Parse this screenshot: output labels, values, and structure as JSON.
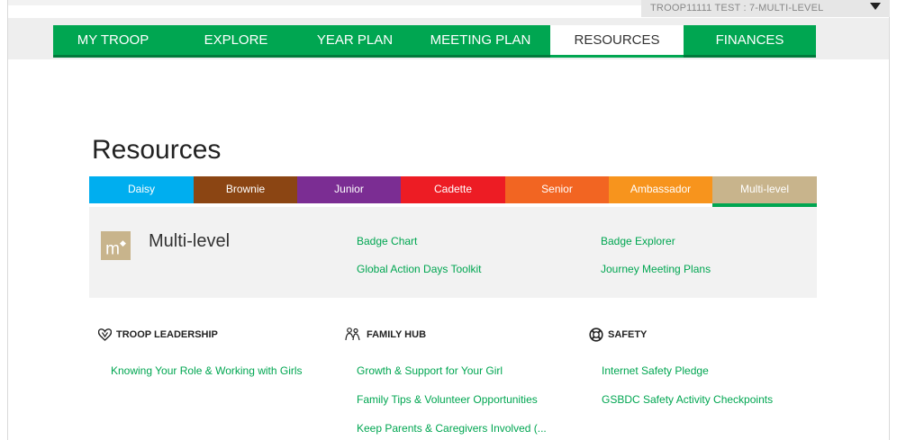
{
  "troop_selector": {
    "label": "TROOP11111 TEST : 7-MULTI-LEVEL"
  },
  "nav": {
    "items": [
      {
        "label": "MY TROOP"
      },
      {
        "label": "EXPLORE"
      },
      {
        "label": "YEAR PLAN"
      },
      {
        "label": "MEETING PLAN"
      },
      {
        "label": "RESOURCES"
      },
      {
        "label": "FINANCES"
      }
    ],
    "active": "RESOURCES"
  },
  "page_title": "Resources",
  "levels": [
    {
      "label": "Daisy",
      "color": "#00aeef"
    },
    {
      "label": "Brownie",
      "color": "#8b4513"
    },
    {
      "label": "Junior",
      "color": "#7b2d93"
    },
    {
      "label": "Cadette",
      "color": "#ed1c24"
    },
    {
      "label": "Senior",
      "color": "#f26522"
    },
    {
      "label": "Ambassador",
      "color": "#f7941d"
    },
    {
      "label": "Multi-level",
      "color": "#c8b48c"
    }
  ],
  "selected_level": {
    "badge": "m",
    "name": "Multi-level",
    "links": [
      "Badge Chart",
      "Global Action Days Toolkit",
      "Badge Explorer",
      "Journey Meeting Plans"
    ]
  },
  "sections": [
    {
      "title": "TROOP LEADERSHIP",
      "icon": "heart-hands-icon",
      "links": [
        "Knowing Your Role & Working with Girls"
      ]
    },
    {
      "title": "FAMILY HUB",
      "icon": "family-icon",
      "links": [
        "Growth & Support for Your Girl",
        "Family Tips & Volunteer Opportunities",
        "Keep Parents & Caregivers Involved (..."
      ]
    },
    {
      "title": "SAFETY",
      "icon": "life-ring-icon",
      "links": [
        "Internet Safety Pledge",
        "GSBDC Safety Activity Checkpoints"
      ]
    }
  ],
  "colors": {
    "brand_green": "#00a651",
    "nav_dark_green": "#007a3b",
    "panel_bg": "#f2f2f2"
  }
}
